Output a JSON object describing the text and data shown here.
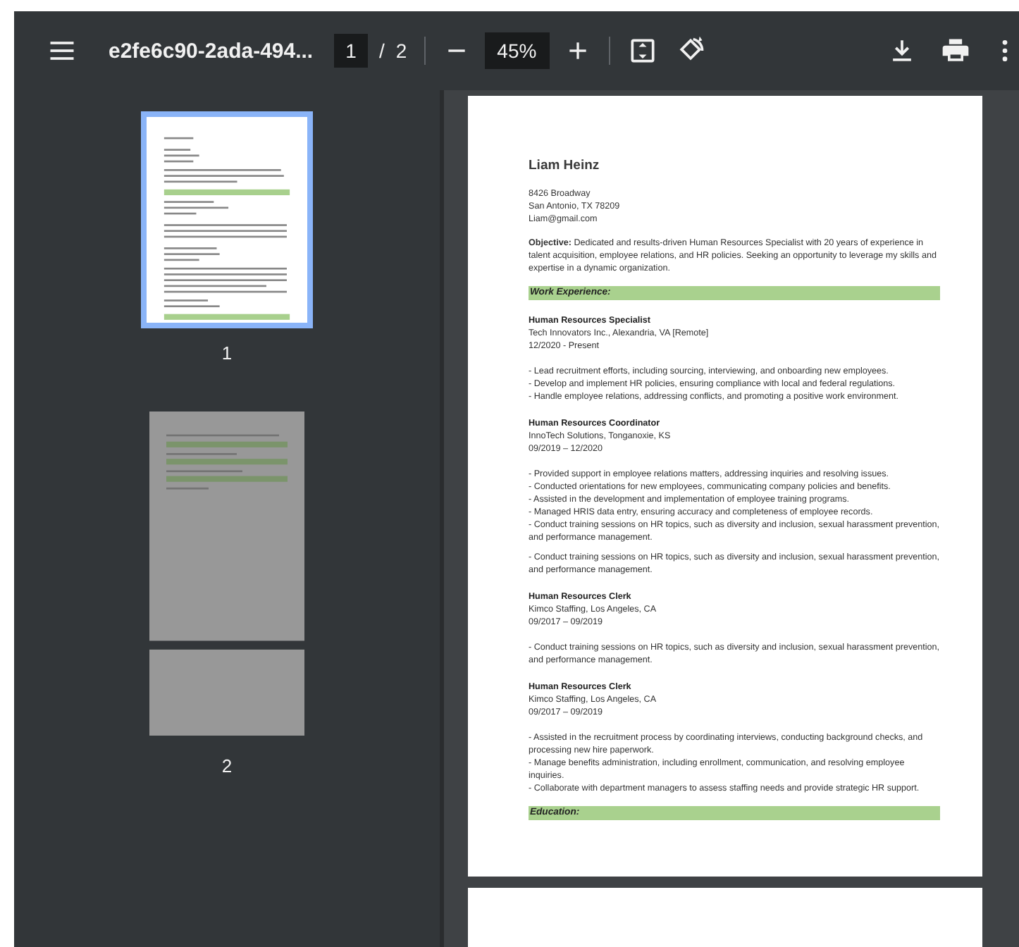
{
  "toolbar": {
    "title": "e2fe6c90-2ada-494...",
    "page_input": "1",
    "page_separator": "/",
    "page_total": "2",
    "zoom": "45%"
  },
  "thumbnails": [
    {
      "label": "1",
      "selected": true
    },
    {
      "label": "2",
      "selected": false
    }
  ],
  "document": {
    "name": "Liam Heinz",
    "contact": [
      "8426 Broadway",
      "San Antonio, TX 78209",
      "Liam@gmail.com"
    ],
    "objective": "**Objective:** Dedicated and results-driven Human Resources Specialist with 20 years of experience in talent acquisition, employee relations, and HR policies. Seeking an opportunity to leverage my skills and expertise in a dynamic organization.",
    "sections": [
      {
        "heading": "Work Experience:",
        "jobs": [
          {
            "title": "Human Resources Specialist",
            "company": "Tech Innovators Inc., Alexandria, VA [Remote]",
            "dates": "12/2020 - Present",
            "paragraphs": [
              [
                "- Lead recruitment efforts, including sourcing, interviewing, and onboarding new employees.",
                "- Develop and implement HR policies, ensuring compliance with local and federal regulations.",
                "- Handle employee relations, addressing conflicts, and promoting a positive work environment."
              ]
            ]
          },
          {
            "title": "Human Resources Coordinator",
            "company": "InnoTech Solutions, Tonganoxie, KS",
            "dates": "09/2019 – 12/2020",
            "paragraphs": [
              [
                "- Provided support in employee relations matters, addressing inquiries and resolving issues.",
                "- Conducted orientations for new employees, communicating company policies and benefits.",
                "- Assisted in the development and implementation of employee training programs.",
                "- Managed HRIS data entry, ensuring accuracy and completeness of employee records.",
                "- Conduct training sessions on HR topics, such as diversity and inclusion, sexual harassment prevention, and performance management."
              ],
              [
                "- Conduct training sessions on HR topics, such as diversity and inclusion, sexual harassment prevention, and performance management."
              ]
            ]
          },
          {
            "title": "Human Resources Clerk",
            "company": "Kimco Staffing, Los Angeles, CA",
            "dates": "09/2017 – 09/2019",
            "paragraphs": [
              [
                "- Conduct training sessions on HR topics, such as diversity and inclusion, sexual harassment prevention, and performance management."
              ]
            ]
          },
          {
            "title": "Human Resources Clerk",
            "company": "Kimco Staffing, Los Angeles, CA",
            "dates": "09/2017 – 09/2019",
            "paragraphs": [
              [
                "- Assisted in the recruitment process by coordinating interviews, conducting background checks, and processing new hire paperwork.",
                "- Manage benefits administration, including enrollment, communication, and resolving employee inquiries.",
                "- Collaborate with department managers to assess staffing needs and provide strategic HR support."
              ]
            ]
          }
        ]
      },
      {
        "heading": "Education:"
      }
    ]
  }
}
